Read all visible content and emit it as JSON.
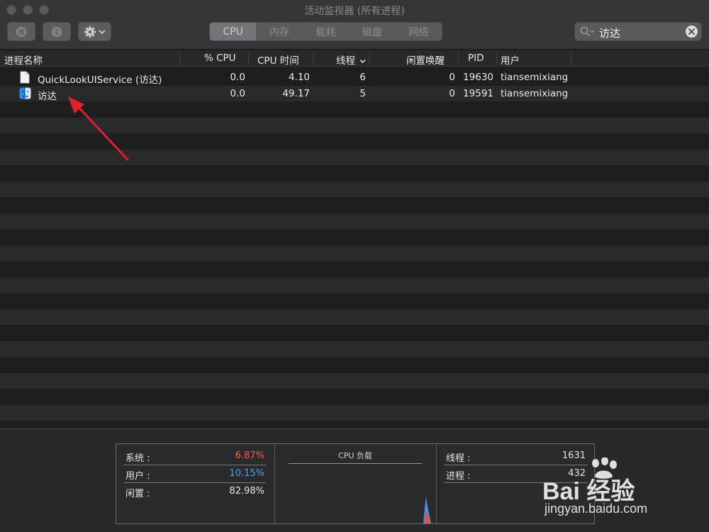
{
  "window": {
    "title": "活动监视器 (所有进程)"
  },
  "toolbar": {
    "tabs": [
      {
        "label": "CPU",
        "active": true
      },
      {
        "label": "内存",
        "active": false
      },
      {
        "label": "能耗",
        "active": false
      },
      {
        "label": "磁盘",
        "active": false
      },
      {
        "label": "网络",
        "active": false
      }
    ],
    "search_value": "访达"
  },
  "columns": {
    "name": "进程名称",
    "cpu_pct": "% CPU",
    "cpu_time": "CPU 时间",
    "threads": "线程",
    "idle_wakeups": "闲置唤醒",
    "pid": "PID",
    "user": "用户"
  },
  "processes": [
    {
      "name": "QuickLookUIService (访达)",
      "icon": "document-icon",
      "cpu_pct": "0.0",
      "cpu_time": "4.10",
      "threads": "6",
      "idle_wakeups": "0",
      "pid": "19630",
      "user": "tiansemixiang"
    },
    {
      "name": "访达",
      "icon": "finder-icon",
      "cpu_pct": "0.0",
      "cpu_time": "49.17",
      "threads": "5",
      "idle_wakeups": "0",
      "pid": "19591",
      "user": "tiansemixiang"
    }
  ],
  "summary": {
    "system_label": "系统 :",
    "system_value": "6.87%",
    "user_label": "用户 :",
    "user_value": "10.15%",
    "idle_label": "闲置 :",
    "idle_value": "82.98%",
    "load_title": "CPU 负载",
    "threads_label": "线程 :",
    "threads_value": "1631",
    "processes_label": "进程 :",
    "processes_value": "432"
  },
  "colors": {
    "system": "#ff5a4e",
    "user": "#4aa3f0",
    "annotation_arrow": "#e0202a"
  },
  "watermark": {
    "brand": "Bai 经验",
    "url": "jingyan.baidu.com"
  }
}
